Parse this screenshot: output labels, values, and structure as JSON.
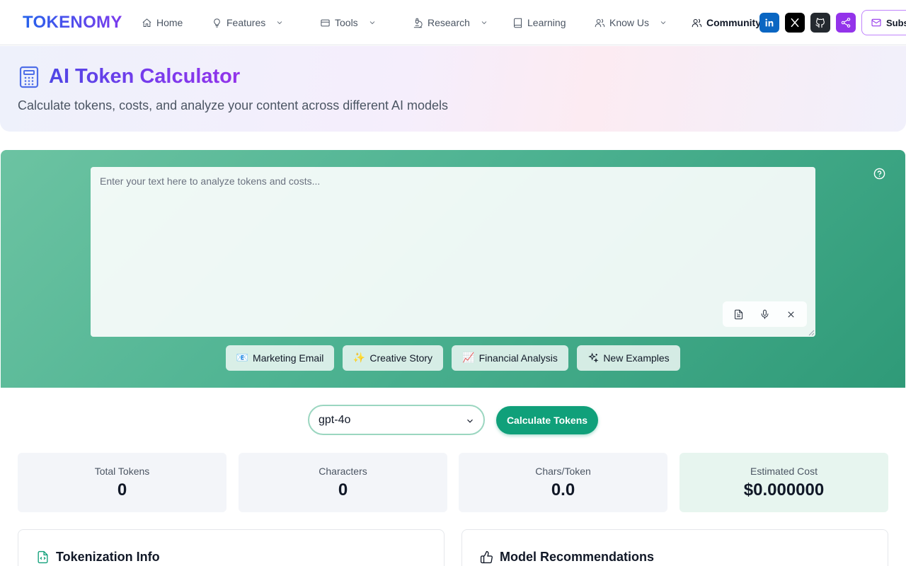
{
  "brand": "TOKENOMY",
  "nav": {
    "home": "Home",
    "features": "Features",
    "tools": "Tools",
    "research": "Research",
    "learning": "Learning",
    "know_us": "Know Us",
    "community": "Community"
  },
  "social": {
    "linkedin_label": "in",
    "linkedin_color": "#0a66c2",
    "x_color": "#000000",
    "github_color": "#24292f",
    "share_color": "#9333ea"
  },
  "subscribe_label": "Subscribe",
  "hero": {
    "title": "AI Token Calculator",
    "subtitle": "Calculate tokens, costs, and analyze your content across different AI models"
  },
  "editor": {
    "placeholder": "Enter your text here to analyze tokens and costs...",
    "value": ""
  },
  "examples": [
    {
      "emoji": "📧",
      "label": "Marketing Email"
    },
    {
      "emoji": "✨",
      "label": "Creative Story"
    },
    {
      "emoji": "📈",
      "label": "Financial Analysis"
    },
    {
      "emoji": "",
      "label": "New Examples"
    }
  ],
  "model": {
    "selected": "gpt-4o",
    "calculate_label": "Calculate Tokens"
  },
  "stats": [
    {
      "label": "Total Tokens",
      "value": "0"
    },
    {
      "label": "Characters",
      "value": "0"
    },
    {
      "label": "Chars/Token",
      "value": "0.0"
    },
    {
      "label": "Estimated Cost",
      "value": "$0.000000"
    }
  ],
  "cards": {
    "tokenization_title": "Tokenization Info",
    "recommendations_title": "Model Recommendations"
  },
  "colors": {
    "accent": "#10a07a",
    "brand_start": "#2563eb",
    "brand_end": "#7c3aed"
  }
}
